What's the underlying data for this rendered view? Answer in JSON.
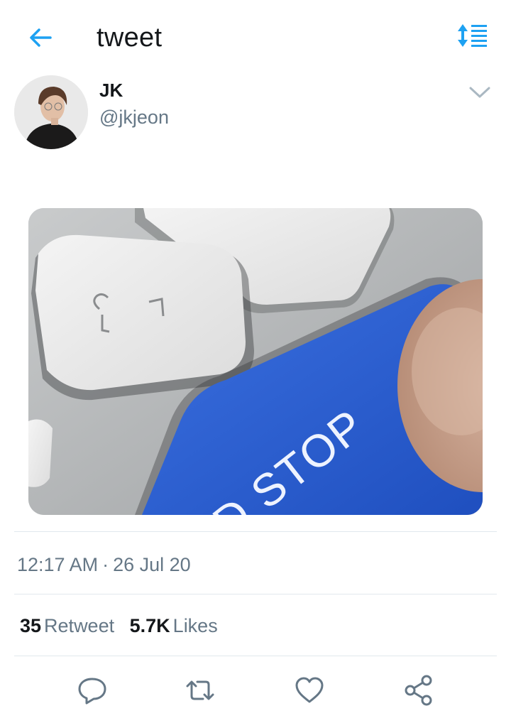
{
  "header": {
    "title": "tweet",
    "back_icon": "arrow-left-icon",
    "sort_icon": "sort-list-icon"
  },
  "author": {
    "name": "JK",
    "handle": "@jkjeon",
    "menu_icon": "chevron-down-icon"
  },
  "media": {
    "caption_text": "ND STOP"
  },
  "meta": {
    "time": "12:17 AM",
    "separator": "·",
    "date": "26 Jul 20"
  },
  "stats": {
    "retweets_count": "35",
    "retweets_label": "Retweet",
    "likes_count": "5.7K",
    "likes_label": "Likes"
  },
  "actions": {
    "reply_icon": "reply-icon",
    "retweet_icon": "retweet-icon",
    "like_icon": "heart-icon",
    "share_icon": "share-icon"
  },
  "colors": {
    "accent": "#1da1f2",
    "text": "#14171a",
    "secondary_text": "#657786",
    "divider": "#e1e8ed",
    "key_blue": "#2a5fd0"
  }
}
